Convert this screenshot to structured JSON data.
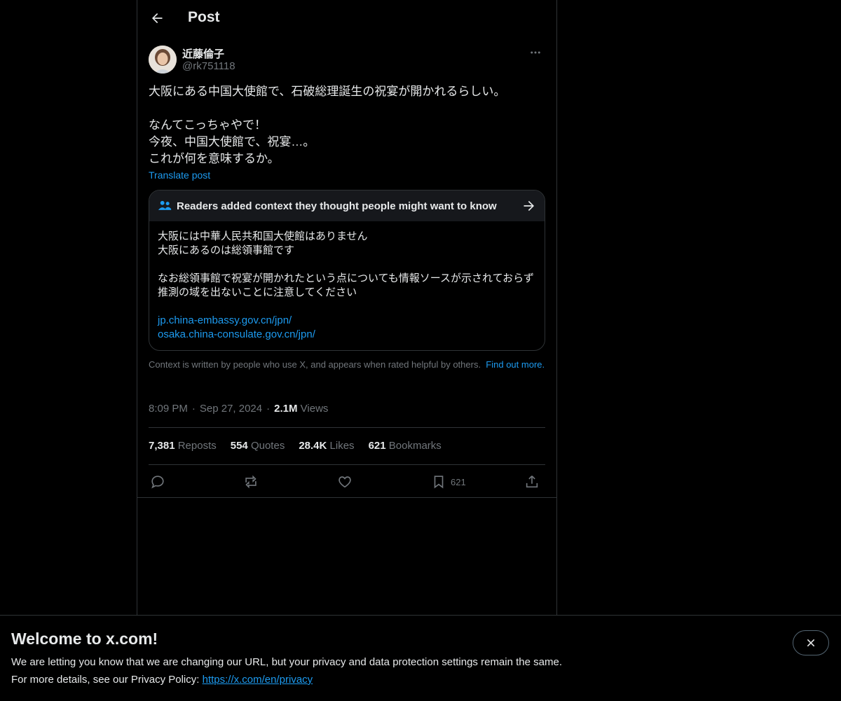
{
  "header": {
    "title": "Post"
  },
  "author": {
    "display_name": "近藤倫子",
    "handle": "@rk751118"
  },
  "post": {
    "text": "大阪にある中国大使館で、石破総理誕生の祝宴が開かれるらしい。\n\nなんてこっちゃやで！\n今夜、中国大使館で、祝宴…。\nこれが何を意味するか。",
    "translate_label": "Translate post"
  },
  "note": {
    "title": "Readers added context they thought people might want to know",
    "line1": "大阪には中華人民共和国大使館はありません",
    "line2": "大阪にあるのは総領事館です",
    "line3": "なお総領事館で祝宴が開かれたという点についても情報ソースが示されておらず",
    "line4": "推測の域を出ないことに注意してください",
    "link1": "jp.china-embassy.gov.cn/jpn/",
    "link2": "osaka.china-consulate.gov.cn/jpn/"
  },
  "note_footer": {
    "text": "Context is written by people who use X, and appears when rated helpful by others.",
    "find_out": "Find out more."
  },
  "meta": {
    "time": "8:09 PM",
    "date": "Sep 27, 2024",
    "views_count": "2.1M",
    "views_label": "Views"
  },
  "stats": {
    "reposts_count": "7,381",
    "reposts_label": "Reposts",
    "quotes_count": "554",
    "quotes_label": "Quotes",
    "likes_count": "28.4K",
    "likes_label": "Likes",
    "bookmarks_count": "621",
    "bookmarks_label": "Bookmarks"
  },
  "actions": {
    "bookmark_count": "621"
  },
  "icons": [
    "back-arrow-icon",
    "more-icon",
    "people-icon",
    "arrow-right-icon",
    "reply-icon",
    "repost-icon",
    "like-icon",
    "bookmark-icon",
    "share-icon",
    "close-icon"
  ],
  "colors": {
    "background": "#000000",
    "accent": "#1d9bf0",
    "text": "#e7e9ea",
    "muted": "#71767b",
    "border": "#2f3336"
  },
  "banner": {
    "title": "Welcome to x.com!",
    "line1": "We are letting you know that we are changing our URL, but your privacy and data protection settings remain the same.",
    "line2_prefix": "For more details, see our Privacy Policy:",
    "link": "https://x.com/en/privacy"
  }
}
